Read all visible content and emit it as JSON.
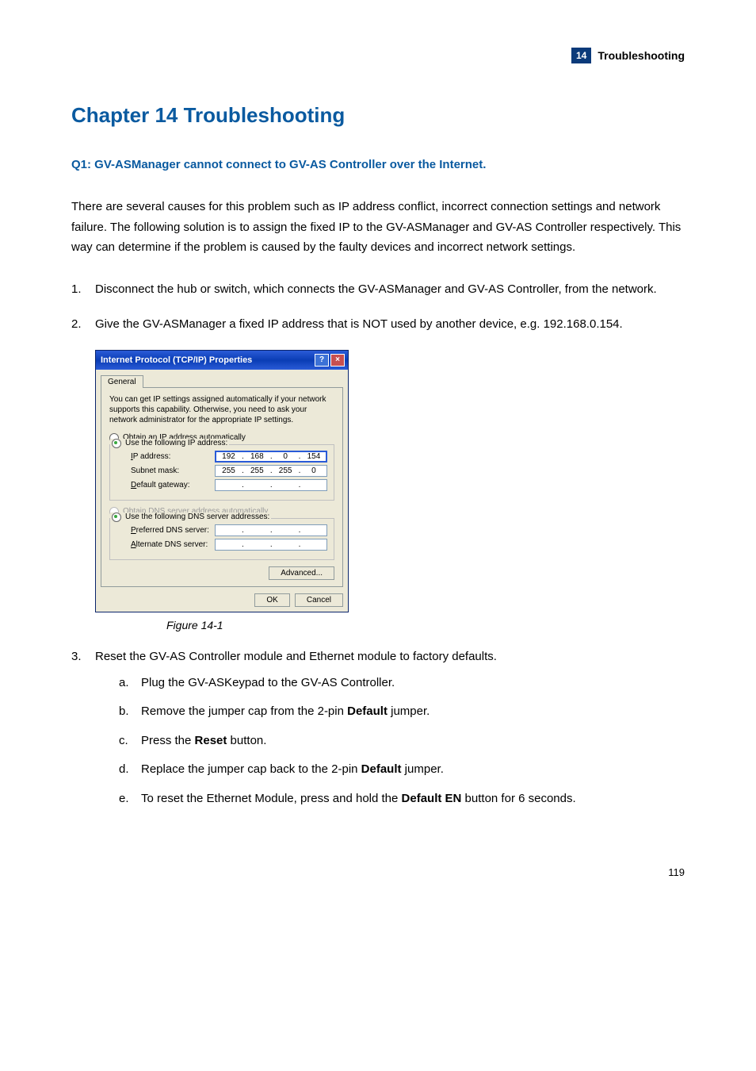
{
  "header": {
    "badge_number": "14",
    "label": "Troubleshooting"
  },
  "chapter_title": "Chapter 14    Troubleshooting",
  "q1_title": "Q1: GV-ASManager cannot connect to GV-AS Controller over the Internet.",
  "intro_paragraph": "There are several causes for this problem such as IP address conflict, incorrect connection settings and network failure. The following solution is to assign the fixed IP to the GV-ASManager and GV-AS Controller respectively. This way can determine if the problem is caused by the faulty devices and incorrect network settings.",
  "step1": {
    "num": "1.",
    "text": "Disconnect the hub or switch, which connects the GV-ASManager and GV-AS Controller, from the network."
  },
  "step2": {
    "num": "2.",
    "text": "Give the GV-ASManager a fixed IP address that is NOT used by another device, e.g. 192.168.0.154."
  },
  "figure_caption": "Figure 14-1",
  "step3": {
    "num": "3.",
    "text": "Reset the GV-AS Controller module and Ethernet module to factory defaults.",
    "a": {
      "letter": "a.",
      "text": "Plug the GV-ASKeypad to the GV-AS Controller."
    },
    "b": {
      "letter": "b.",
      "pre": "Remove the jumper cap from the 2-pin ",
      "bold": "Default",
      "post": " jumper."
    },
    "c": {
      "letter": "c.",
      "pre": "Press the ",
      "bold": "Reset",
      "post": " button."
    },
    "d": {
      "letter": "d.",
      "pre": "Replace the jumper cap back to the 2-pin ",
      "bold": "Default",
      "post": " jumper."
    },
    "e": {
      "letter": "e.",
      "pre": "To reset the Ethernet Module, press and hold the ",
      "bold": "Default EN",
      "post": " button for 6 seconds."
    }
  },
  "page_number": "119",
  "dialog": {
    "title": "Internet Protocol (TCP/IP) Properties",
    "tab": "General",
    "description": "You can get IP settings assigned automatically if your network supports this capability. Otherwise, you need to ask your network administrator for the appropriate IP settings.",
    "radio_obtain_ip": "Obtain an IP address automatically",
    "radio_use_ip": "Use the following IP address:",
    "label_ip": "IP address:",
    "label_subnet": "Subnet mask:",
    "label_gateway": "Default gateway:",
    "radio_obtain_dns": "Obtain DNS server address automatically",
    "radio_use_dns": "Use the following DNS server addresses:",
    "label_pref_dns": "Preferred DNS server:",
    "label_alt_dns": "Alternate DNS server:",
    "btn_advanced": "Advanced...",
    "btn_ok": "OK",
    "btn_cancel": "Cancel",
    "ip": {
      "a": "192",
      "b": "168",
      "c": "0",
      "d": "154"
    },
    "subnet": {
      "a": "255",
      "b": "255",
      "c": "255",
      "d": "0"
    }
  }
}
